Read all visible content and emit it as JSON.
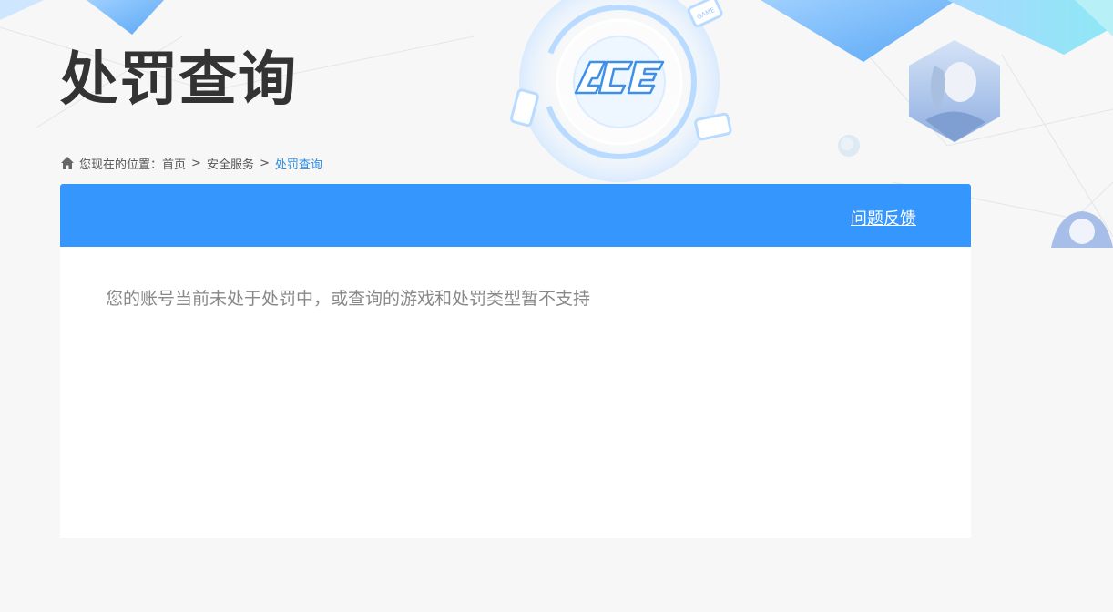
{
  "header": {
    "title": "处罚查询",
    "logo_text": "ACE",
    "badge_text": "GAME"
  },
  "breadcrumb": {
    "prefix": "您现在的位置：",
    "items": [
      {
        "label": "首页"
      },
      {
        "label": "安全服务"
      },
      {
        "label": "处罚查询"
      }
    ],
    "separator": ">"
  },
  "panel": {
    "feedback_label": "问题反馈",
    "message": "您的账号当前未处于处罚中，或查询的游戏和处罚类型暂不支持"
  },
  "colors": {
    "accent": "#3596fd",
    "breadcrumb_current": "#2d8fe6",
    "title": "#333333",
    "message": "#888888"
  },
  "icons": {
    "home": "home-icon",
    "logo": "ace-logo",
    "game_device": "game-device-icon"
  }
}
